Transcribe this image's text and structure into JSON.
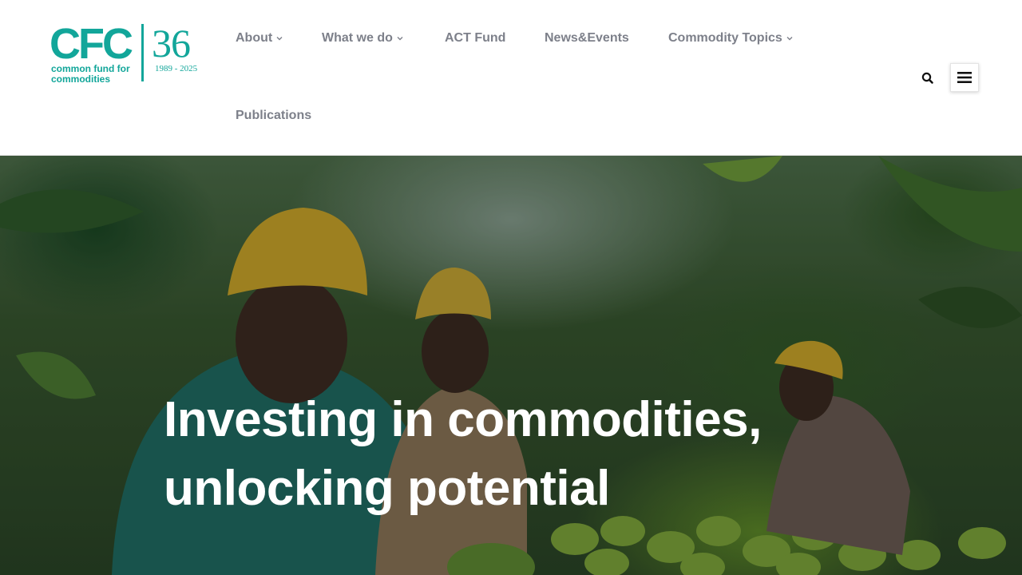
{
  "logo": {
    "mark": "CFC",
    "number": "36",
    "years": "1989 - 2025",
    "tagline": "common fund for commodities",
    "brand_color": "#12a69a"
  },
  "nav": {
    "items": [
      {
        "label": "About",
        "has_dropdown": true
      },
      {
        "label": "What we do",
        "has_dropdown": true
      },
      {
        "label": "ACT Fund",
        "has_dropdown": false
      },
      {
        "label": "News&Events",
        "has_dropdown": false
      },
      {
        "label": "Commodity Topics",
        "has_dropdown": true
      },
      {
        "label": "Publications",
        "has_dropdown": false
      }
    ],
    "text_color": "#7d808a"
  },
  "header_actions": {
    "search_icon": "search-icon",
    "menu_icon": "hamburger-icon"
  },
  "hero": {
    "title_line1": "Investing in commodities,",
    "title_line2": "unlocking potential",
    "image_subject": "farm workers harvesting avocados"
  }
}
